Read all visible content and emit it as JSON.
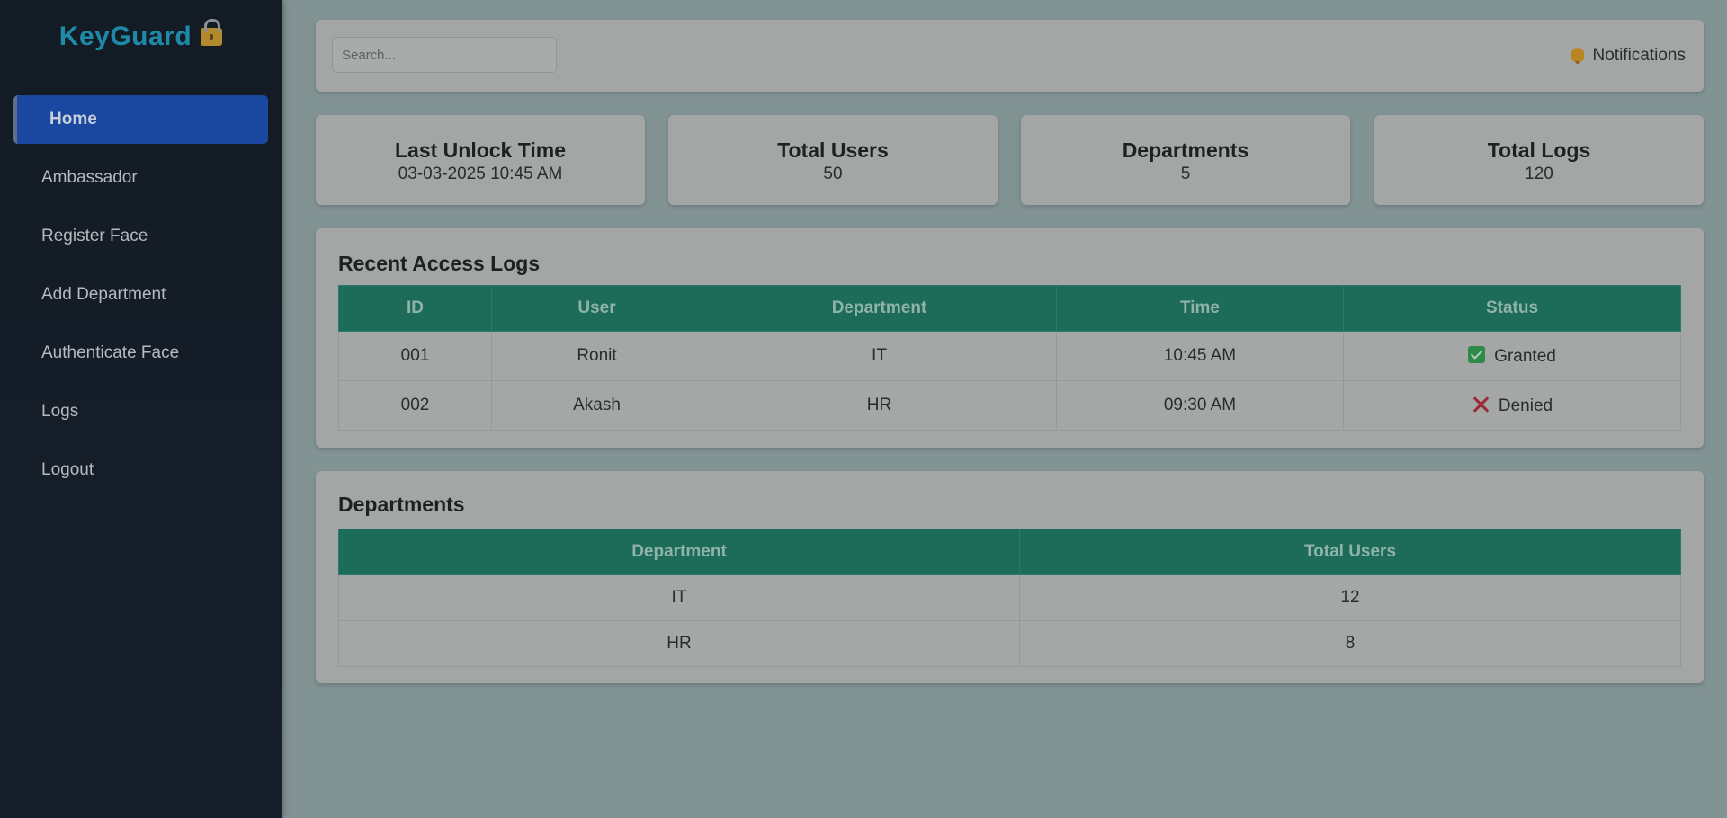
{
  "sidebar": {
    "brand": "KeyGuard",
    "brand_icon": "padlock-icon",
    "items": [
      {
        "label": "Home",
        "active": true
      },
      {
        "label": "Ambassador"
      },
      {
        "label": "Register Face"
      },
      {
        "label": "Add Department"
      },
      {
        "label": "Authenticate Face"
      },
      {
        "label": "Logs"
      },
      {
        "label": "Logout"
      }
    ]
  },
  "header": {
    "search_placeholder": "Search...",
    "notifications_label": "Notifications",
    "notifications_icon": "bell-icon"
  },
  "stats": [
    {
      "title": "Last Unlock Time",
      "value": "03-03-2025 10:45 AM"
    },
    {
      "title": "Total Users",
      "value": "50"
    },
    {
      "title": "Departments",
      "value": "5"
    },
    {
      "title": "Total Logs",
      "value": "120"
    }
  ],
  "recent_logs": {
    "title": "Recent Access Logs",
    "columns": [
      "ID",
      "User",
      "Department",
      "Time",
      "Status"
    ],
    "rows": [
      {
        "id": "001",
        "user": "Ronit",
        "department": "IT",
        "time": "10:45 AM",
        "status": "Granted",
        "status_icon": "check-icon"
      },
      {
        "id": "002",
        "user": "Akash",
        "department": "HR",
        "time": "09:30 AM",
        "status": "Denied",
        "status_icon": "cross-icon"
      }
    ]
  },
  "departments": {
    "title": "Departments",
    "columns": [
      "Department",
      "Total Users"
    ],
    "rows": [
      {
        "department": "IT",
        "total_users": "12"
      },
      {
        "department": "HR",
        "total_users": "8"
      }
    ]
  },
  "colors": {
    "accent_active": "#1a48a0",
    "table_header": "#1d6b59",
    "brand": "#1f89a8",
    "granted": "#2d8a48",
    "denied": "#9a2a35"
  }
}
